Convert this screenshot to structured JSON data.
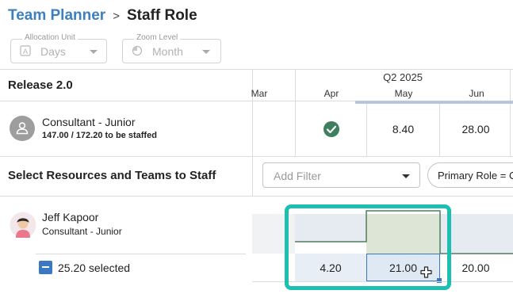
{
  "breadcrumb": {
    "parent": "Team Planner",
    "separator": ">",
    "current": "Staff Role"
  },
  "controls": {
    "allocation_unit": {
      "legend": "Allocation Unit",
      "value": "Days",
      "icon": "calendar-a-icon"
    },
    "zoom_level": {
      "legend": "Zoom Level",
      "value": "Month",
      "icon": "zoom-pie-icon"
    }
  },
  "timeline": {
    "release": "Release 2.0",
    "quarter": "Q2 2025",
    "months": [
      "Mar",
      "Apr",
      "May",
      "Jun"
    ]
  },
  "role_row": {
    "name": "Consultant - Junior",
    "staffing": "147.00 / 172.20 to be staffed",
    "cells": {
      "apr": "check-circle-icon",
      "may": "8.40",
      "jun": "28.00"
    }
  },
  "resources": {
    "title": "Select Resources and Teams to Staff",
    "filter_placeholder": "Add Filter",
    "chip_label": "Primary Role = Consultant - Junior"
  },
  "person": {
    "name": "Jeff Kapoor",
    "role": "Consultant - Junior",
    "selected": "25.20 selected",
    "allocations": {
      "apr": "4.20",
      "may": "21.00",
      "jun": "20.00"
    }
  },
  "colors": {
    "accent": "#3a78c2",
    "link": "#3d7fbf",
    "highlight": "#1dbfb0",
    "check": "#3f7f5f",
    "capacity_area": "#e4eadc",
    "capacity_line": "#4e7e5e",
    "selected_cell": "#dfe9f4"
  }
}
